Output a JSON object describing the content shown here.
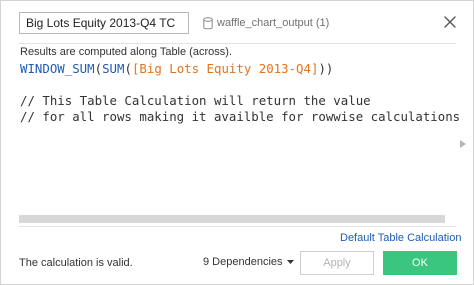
{
  "header": {
    "calc_name": "Big Lots Equity 2013-Q4 TC",
    "datasource_label": "waffle_chart_output (1)",
    "datasource_icon": "database-icon",
    "close_icon": "close-icon"
  },
  "editor": {
    "info_text": "Results are computed along Table (across).",
    "code": {
      "line1_fn_outer": "WINDOW_SUM",
      "line1_paren_open": "(",
      "line1_fn_inner": "SUM",
      "line1_paren_open2": "(",
      "line1_field": "[Big Lots Equity 2013-Q4]",
      "line1_paren_close": "))",
      "line3_comment": "// This Table Calculation will return the value",
      "line4_comment": "// for all rows making it availble for rowwise calculations"
    }
  },
  "links": {
    "default_table_calc": "Default Table Calculation"
  },
  "footer": {
    "status_text": "The calculation is valid.",
    "dependencies_label": "9 Dependencies",
    "apply_label": "Apply",
    "ok_label": "OK"
  },
  "colors": {
    "function": "#1f5cb3",
    "field": "#e2741f",
    "ok_button": "#3bc67f",
    "link": "#1f5cb3"
  }
}
